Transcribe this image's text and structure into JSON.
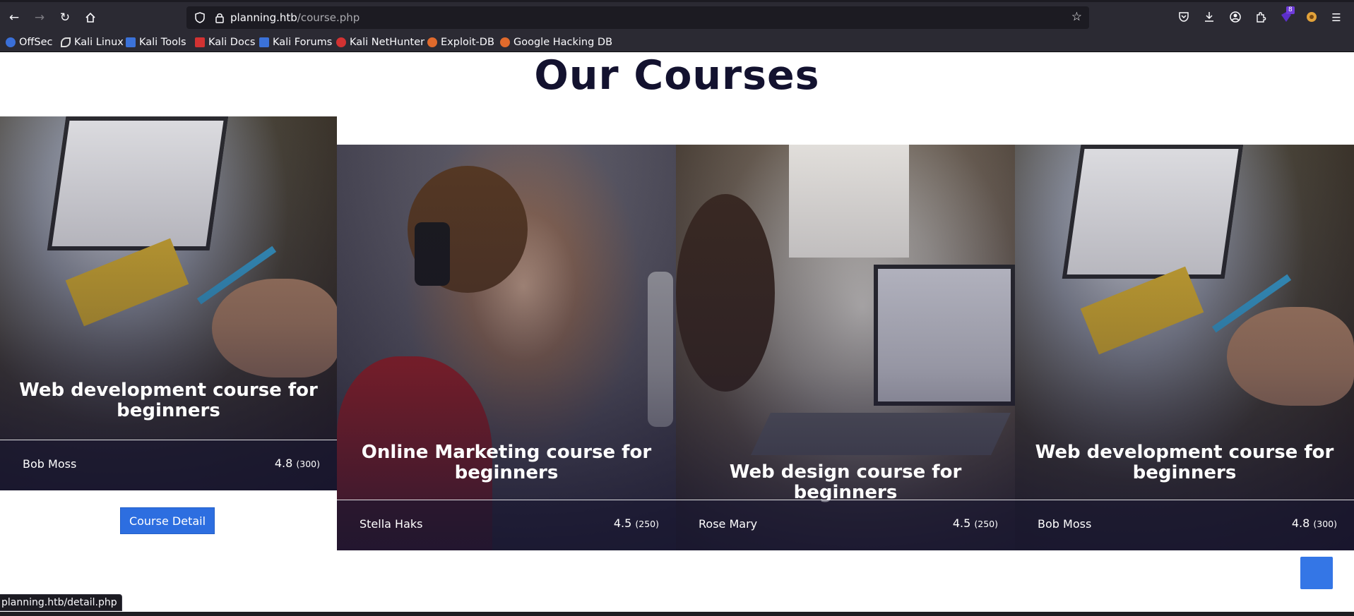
{
  "browser": {
    "url_host": "planning.htb",
    "url_path": "/course.php",
    "extension_badge": "8",
    "status_url": "planning.htb/detail.php",
    "bookmarks": [
      {
        "label": "OffSec",
        "icon": "offsec-icon",
        "color": "#3a6fd8"
      },
      {
        "label": "Kali Linux",
        "icon": "kali-dragon-icon",
        "color": "#dddddd"
      },
      {
        "label": "Kali Tools",
        "icon": "kali-tools-icon",
        "color": "#3b72d9"
      },
      {
        "label": "Kali Docs",
        "icon": "kali-docs-icon",
        "color": "#d23232"
      },
      {
        "label": "Kali Forums",
        "icon": "kali-forums-icon",
        "color": "#3b72d9"
      },
      {
        "label": "Kali NetHunter",
        "icon": "nethunter-icon",
        "color": "#d23232"
      },
      {
        "label": "Exploit-DB",
        "icon": "exploit-db-icon",
        "color": "#e06a2c"
      },
      {
        "label": "Google Hacking DB",
        "icon": "ghdb-icon",
        "color": "#e06a2c"
      }
    ]
  },
  "page": {
    "title": "Our Courses",
    "detail_button": "Course Detail",
    "accent": "#2d6ee0"
  },
  "courses": [
    {
      "title": "Web development course for beginners",
      "instructor": "Bob Moss",
      "rating": "4.8",
      "reviews": "(300)"
    },
    {
      "title": "Online Marketing course for beginners",
      "instructor": "Stella Haks",
      "rating": "4.5",
      "reviews": "(250)"
    },
    {
      "title": "Web design course for beginners",
      "instructor": "Rose Mary",
      "rating": "4.5",
      "reviews": "(250)"
    },
    {
      "title": "Web development course for beginners",
      "instructor": "Bob Moss",
      "rating": "4.8",
      "reviews": "(300)"
    }
  ]
}
